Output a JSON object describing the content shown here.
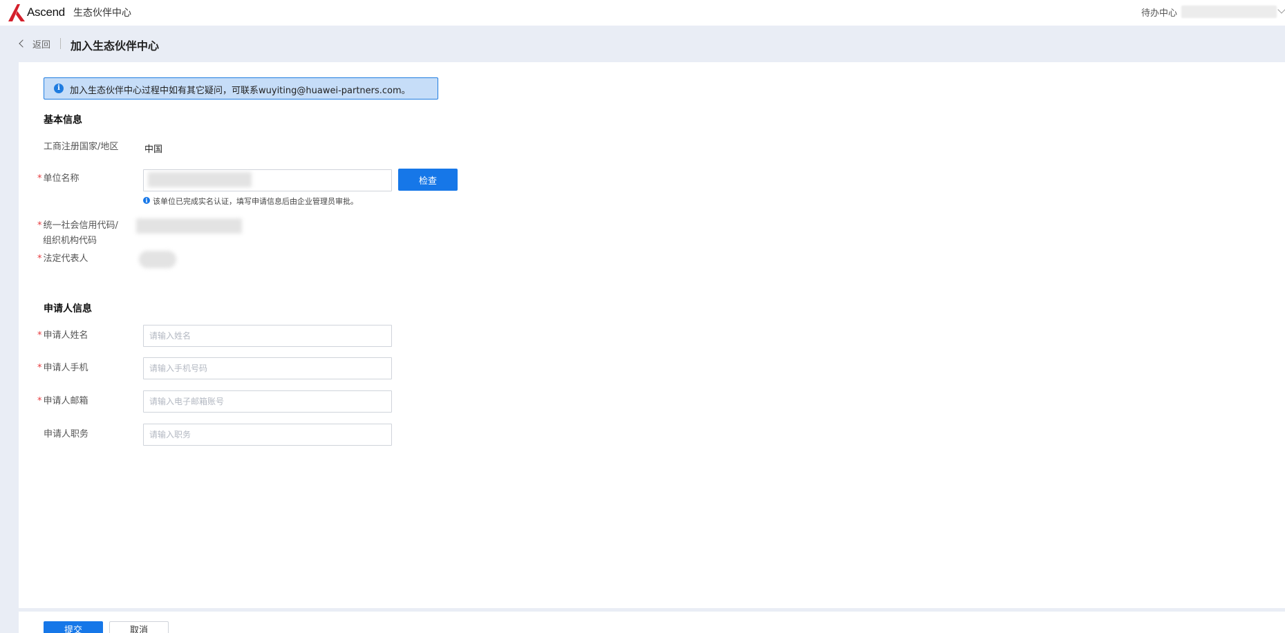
{
  "header": {
    "brand": "Ascend",
    "app_title": "生态伙伴中心",
    "todo_label": "待办中心",
    "logo_icon": "ascend-logo"
  },
  "breadcrumb": {
    "back_label": "返回",
    "page_title": "加入生态伙伴中心"
  },
  "notice": {
    "text": "加入生态伙伴中心过程中如有其它疑问，可联系wuyiting@huawei-partners.com。",
    "icon": "info-icon"
  },
  "basic_info": {
    "section_title": "基本信息",
    "country_label": "工商注册国家/地区",
    "country_value": "中国",
    "org_name_label": "单位名称",
    "check_button": "检查",
    "hint_text": "该单位已完成实名认证，填写申请信息后由企业管理员审批。",
    "credit_code_label_line1": "统一社会信用代码/",
    "credit_code_label_line2": "组织机构代码",
    "legal_rep_label": "法定代表人"
  },
  "applicant_info": {
    "section_title": "申请人信息",
    "fields": [
      {
        "label": "申请人姓名",
        "placeholder": "请输入姓名",
        "required": true
      },
      {
        "label": "申请人手机",
        "placeholder": "请输入手机号码",
        "required": true
      },
      {
        "label": "申请人邮箱",
        "placeholder": "请输入电子邮箱账号",
        "required": true
      },
      {
        "label": "申请人职务",
        "placeholder": "请输入职务",
        "required": false
      }
    ]
  },
  "footer": {
    "submit_label": "提交",
    "cancel_label": "取消"
  },
  "colors": {
    "primary": "#1677e8",
    "required": "#e6393d",
    "notice_bg": "#c6ddf8",
    "page_bg": "#e9edf5"
  }
}
